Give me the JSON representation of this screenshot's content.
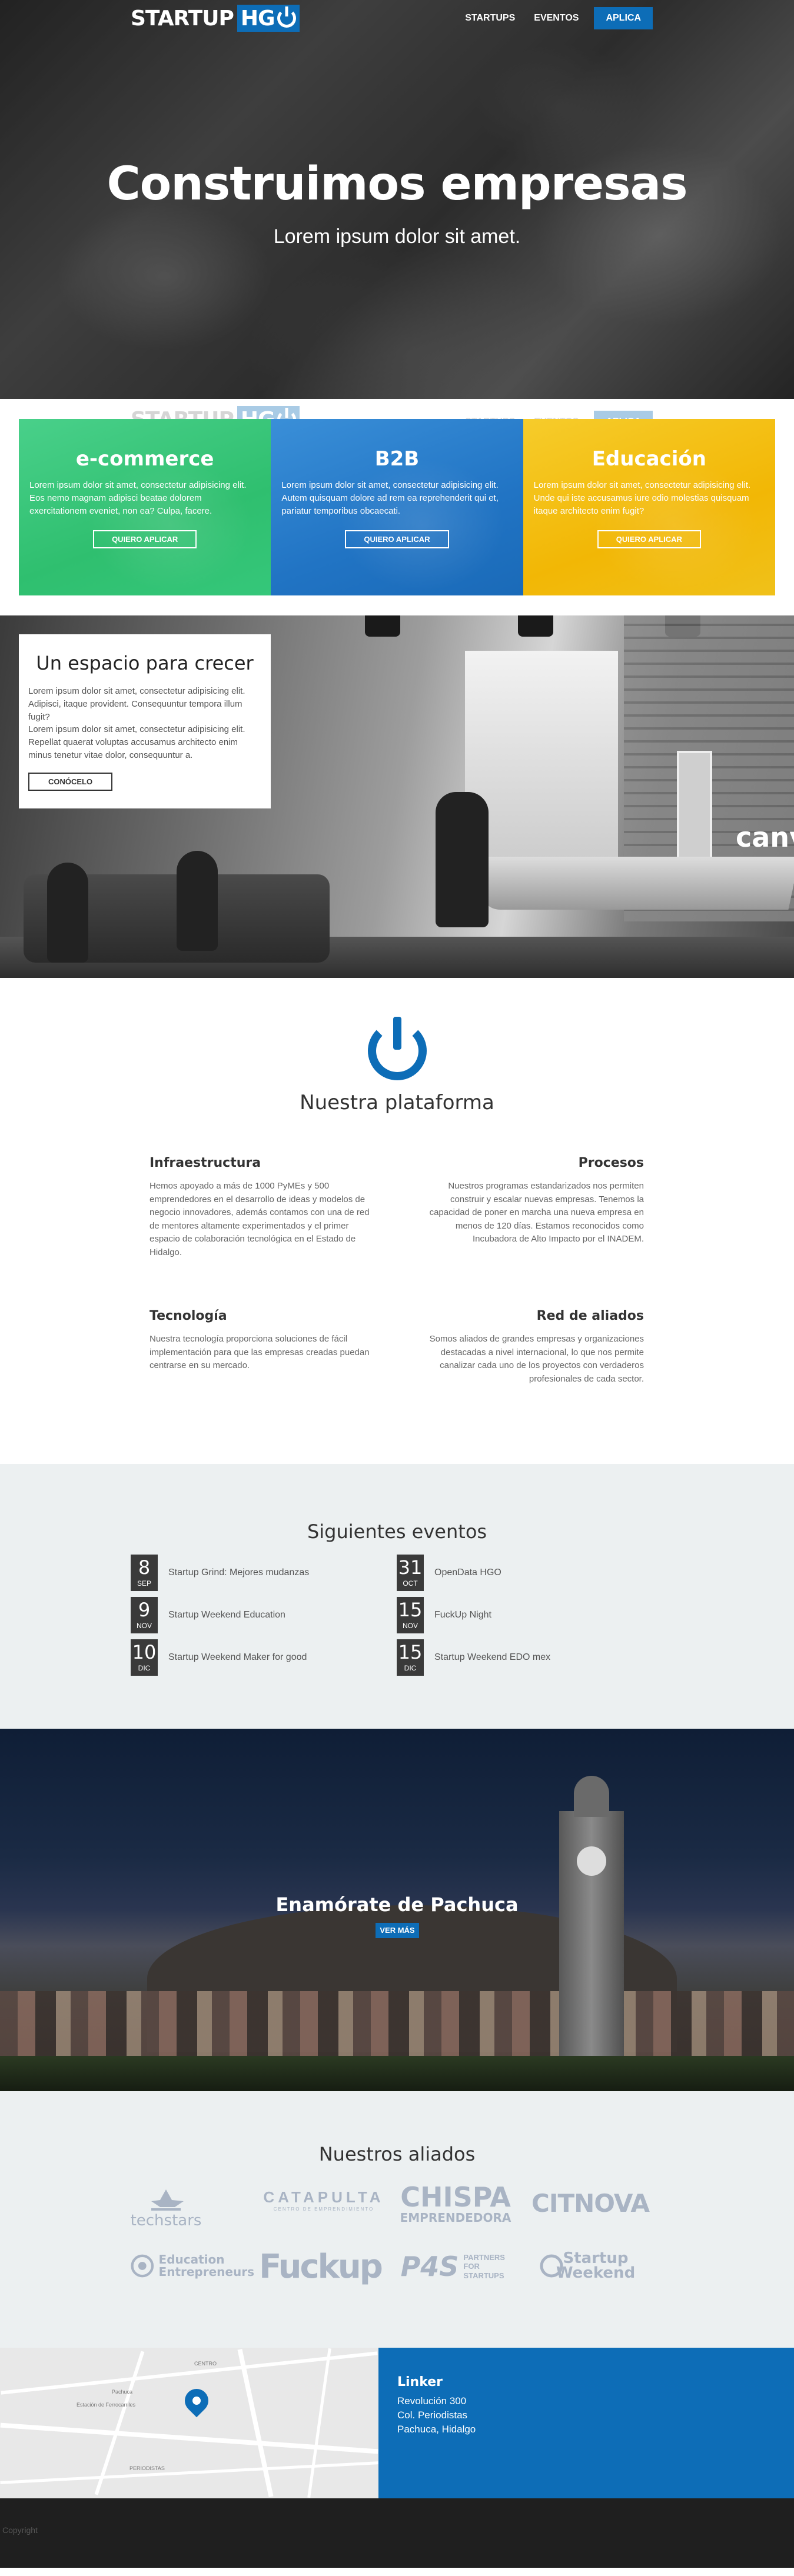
{
  "brand": {
    "word": "STARTUP",
    "mark": "HG"
  },
  "nav": {
    "startups": "STARTUPS",
    "eventos": "EVENTOS",
    "aplica": "APLICA"
  },
  "hero": {
    "title": "Construimos empresas",
    "subtitle": "Lorem ipsum dolor sit amet."
  },
  "categories": [
    {
      "title": "e-commerce",
      "text": "Lorem ipsum dolor sit amet, consectetur adipisicing elit. Eos nemo magnam adipisci beatae dolorem exercitationem eveniet, non ea? Culpa, facere.",
      "button": "QUIERO APLICAR",
      "color": "#2fbf6f"
    },
    {
      "title": "B2B",
      "text": "Lorem ipsum dolor sit amet, consectetur adipisicing elit. Autem quisquam dolore ad rem ea reprehenderit qui et, pariatur temporibus obcaecati.",
      "button": "QUIERO APLICAR",
      "color": "#2174c4"
    },
    {
      "title": "Educación",
      "text": "Lorem ipsum dolor sit amet, consectetur adipisicing elit. Unde qui iste accusamus iure odio molestias quisquam itaque architecto enim fugit?",
      "button": "QUIERO APLICAR",
      "color": "#f2b705"
    }
  ],
  "espacio": {
    "title": "Un espacio para crecer",
    "text1": "Lorem ipsum dolor sit amet, consectetur adipisicing elit. Adipisci, itaque provident. Consequuntur tempora illum fugit?",
    "text2": "Lorem ipsum dolor sit amet, consectetur adipisicing elit. Repellat quaerat voluptas accusamus architecto enim minus tenetur vitae dolor, consequuntur a.",
    "button": "CONÓCELO",
    "sign": "canv"
  },
  "plataforma": {
    "title": "Nuestra plataforma",
    "features": [
      {
        "title": "Infraestructura",
        "text": "Hemos apoyado a más de 1000 PyMEs y 500 emprendedores en el desarrollo de ideas y modelos de negocio innovadores, además contamos con una de red de mentores altamente experimentados y el primer espacio de colaboración tecnológica en el Estado de Hidalgo."
      },
      {
        "title": "Procesos",
        "text": "Nuestros programas estandarizados nos permiten construir y escalar nuevas empresas. Tenemos la capacidad de poner en marcha una nueva empresa en menos de 120 días. Estamos reconocidos como Incubadora de Alto Impacto por el INADEM."
      },
      {
        "title": "Tecnología",
        "text": "Nuestra tecnología proporciona soluciones de fácil implementación para que las empresas creadas puedan centrarse en su mercado."
      },
      {
        "title": "Red de aliados",
        "text": "Somos aliados de grandes empresas y organizaciones destacadas a nivel internacional, lo que nos permite canalizar cada uno de los proyectos con verdaderos profesionales de cada sector."
      }
    ]
  },
  "eventos": {
    "title": "Siguientes eventos",
    "items": [
      {
        "day": "8",
        "month": "SEP",
        "name": "Startup Grind: Mejores mudanzas"
      },
      {
        "day": "31",
        "month": "OCT",
        "name": "OpenData HGO"
      },
      {
        "day": "9",
        "month": "NOV",
        "name": "Startup Weekend Education"
      },
      {
        "day": "15",
        "month": "NOV",
        "name": "FuckUp Night"
      },
      {
        "day": "10",
        "month": "DIC",
        "name": "Startup Weekend Maker for good"
      },
      {
        "day": "15",
        "month": "DIC",
        "name": "Startup Weekend EDO mex"
      }
    ]
  },
  "pachuca": {
    "title": "Enamórate de Pachuca",
    "button": "VER MÁS"
  },
  "aliados": {
    "title": "Nuestros aliados",
    "logos": {
      "techstars": "techstars",
      "catapulta": "CATAPULTA",
      "catapulta_sub": "CENTRO DE EMPRENDIMIENTO",
      "chispa1": "CHISPA",
      "chispa2": "EMPRENDEDORA",
      "citnova": "CITNOVA",
      "edu1": "Education",
      "edu2": "Entrepreneurs",
      "fuckup": "Fuckup",
      "p4s": "P4S",
      "p4s_text": "PARTNERS FOR STARTUPS",
      "sw1": "Startup",
      "sw2": "Weekend"
    }
  },
  "contact": {
    "name": "Linker",
    "line1": "Revolución 300",
    "line2": "Col. Periodistas",
    "line3": "Pachuca, Hidalgo"
  },
  "map_labels": {
    "a": "CENTRO",
    "b": "PERIODISTAS",
    "c": "Pachuca",
    "d": "Estación de Ferrocarriles"
  },
  "footer": {
    "text": "Copyright"
  }
}
